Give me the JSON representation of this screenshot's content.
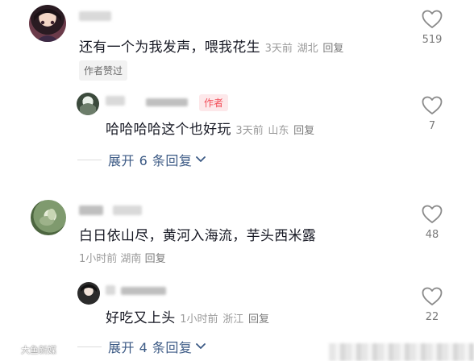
{
  "comments": [
    {
      "text": "还有一个为我发声，喂我花生",
      "time": "3天前",
      "location": "湖北",
      "reply_label": "回复",
      "author_liked": "作者赞过",
      "likes": "519",
      "replies": [
        {
          "author_tag": "作者",
          "text": "哈哈哈哈这个也好玩",
          "time": "3天前",
          "location": "山东",
          "reply_label": "回复",
          "likes": "7"
        }
      ],
      "expand_label": "展开 6 条回复"
    },
    {
      "text": "白日依山尽，黄河入海流，芋头西米露",
      "time": "1小时前",
      "location": "湖南",
      "reply_label": "回复",
      "likes": "48",
      "replies": [
        {
          "text": "好吃又上头",
          "time": "1小时前",
          "location": "浙江",
          "reply_label": "回复",
          "likes": "22"
        }
      ],
      "expand_label": "展开 4 条回复"
    }
  ],
  "watermark": "大鱼新媒",
  "icons": {
    "like": "heart-outline-icon",
    "expand": "chevron-down-icon"
  },
  "colors": {
    "expand_text": "#3c5a85",
    "author_tag_bg": "#fde8ea",
    "author_tag_text": "#f24f5a",
    "meta_text": "#9a9a9a"
  }
}
